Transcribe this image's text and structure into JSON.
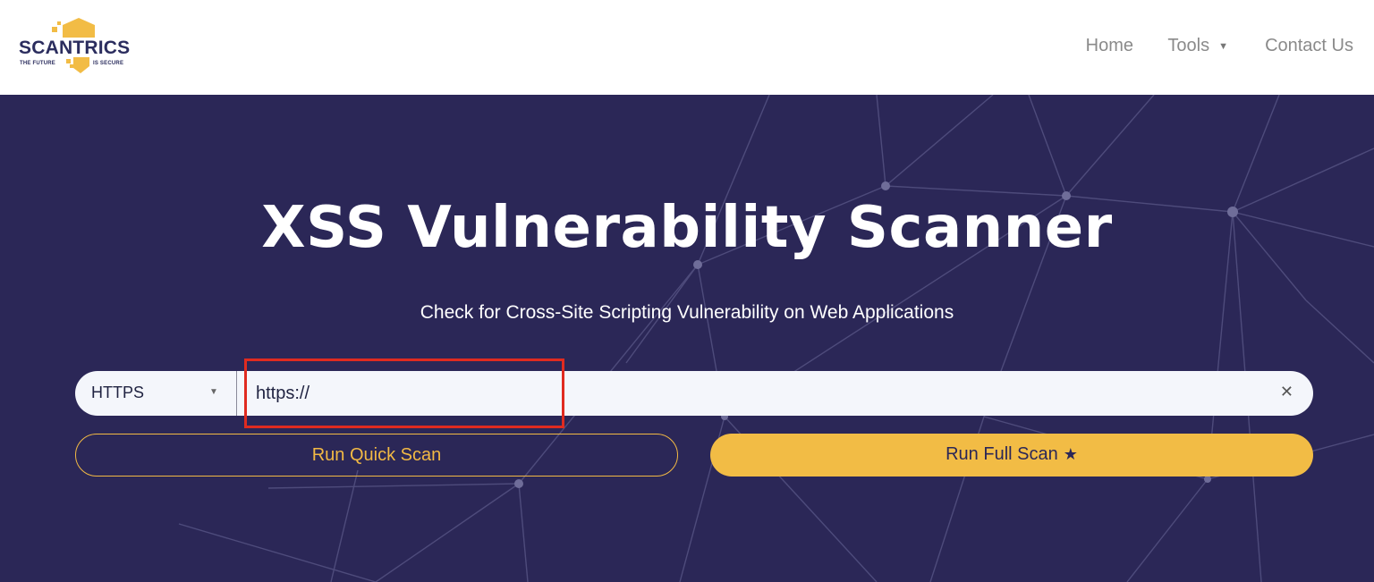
{
  "header": {
    "logo": {
      "name": "SCANTRICS",
      "tagline_left": "THE FUTURE",
      "tagline_right": "IS SECURE"
    },
    "nav": {
      "home": "Home",
      "tools": "Tools",
      "contact": "Contact Us"
    }
  },
  "hero": {
    "title": "XSS Vulnerability Scanner",
    "subtitle": "Check for Cross-Site Scripting Vulnerability on Web Applications",
    "scan_form": {
      "protocol_selected": "HTTPS",
      "url_value": "https://",
      "clear_icon": "close-icon"
    },
    "buttons": {
      "quick_scan": "Run Quick Scan",
      "full_scan": "Run Full Scan"
    }
  },
  "colors": {
    "hero_background": "#2b2757",
    "accent_yellow": "#f2bc45",
    "highlight_red": "#e02b20",
    "nav_text": "#8a8a8a"
  }
}
